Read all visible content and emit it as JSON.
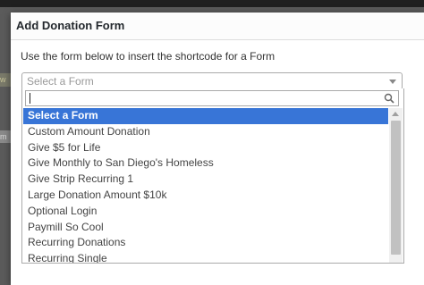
{
  "background": {
    "fragment_1": "w",
    "fragment_2": "m"
  },
  "modal": {
    "title": "Add Donation Form",
    "instructions": "Use the form below to insert the shortcode for a Form"
  },
  "select": {
    "placeholder": "Select a Form",
    "search_value": ""
  },
  "options": [
    "Select a Form",
    "Custom Amount Donation",
    "Give $5 for Life",
    "Give Monthly to San Diego's Homeless",
    "Give Strip Recurring 1",
    "Large Donation Amount $10k",
    "Optional Login",
    "Paymill So Cool",
    "Recurring Donations",
    "Recurring Single"
  ],
  "selected_option": "Select a Form",
  "colors": {
    "highlight": "#3875d7",
    "backdrop": "#5b5b5b"
  },
  "icons": {
    "search": "search-icon",
    "dropdown_caret": "chevron-down-icon"
  }
}
